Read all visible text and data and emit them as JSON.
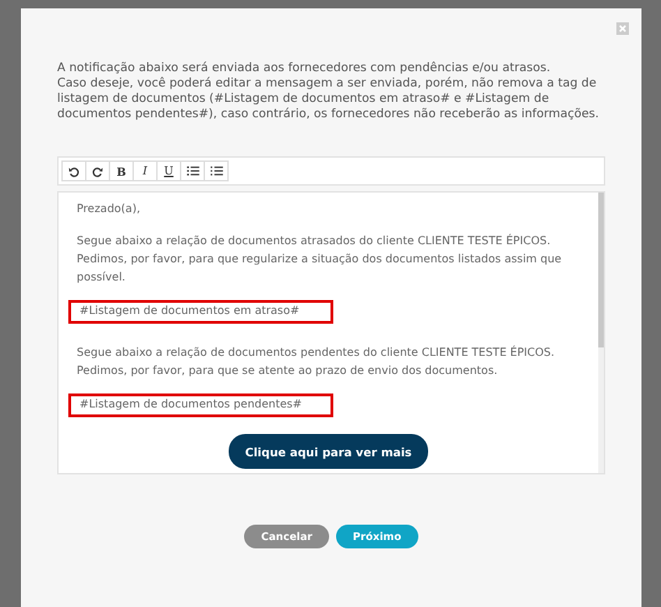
{
  "intro": [
    "A notificação abaixo será enviada aos fornecedores com pendências e/ou atrasos.",
    "Caso deseje, você poderá editar a mensagem a ser enviada, porém, não remova a tag de listagem de documentos (#Listagem de documentos em atraso# e #Listagem de documentos pendentes#), caso contrário, os fornecedores não receberão as informações."
  ],
  "toolbar": [
    {
      "kind": "undo"
    },
    {
      "kind": "redo"
    },
    {
      "kind": "bold",
      "label": "B"
    },
    {
      "kind": "italic",
      "label": "I"
    },
    {
      "kind": "underline",
      "label": "U"
    },
    {
      "kind": "bullets"
    },
    {
      "kind": "numbers"
    }
  ],
  "editor": [
    {
      "kind": "text",
      "text": "Prezado(a),"
    },
    {
      "kind": "text",
      "text": "Segue abaixo a relação de documentos atrasados do cliente CLIENTE TESTE ÉPICOS. Pedimos, por favor, para que regularize a situação dos documentos listados assim que possível."
    },
    {
      "kind": "tag",
      "text": "#Listagem de documentos em atraso#"
    },
    {
      "kind": "text",
      "text": "Segue abaixo a relação de documentos pendentes do cliente CLIENTE TESTE ÉPICOS. Pedimos, por favor, para que se atente ao prazo de envio dos documentos."
    },
    {
      "kind": "tag",
      "text": "#Listagem de documentos pendentes#"
    },
    {
      "kind": "button",
      "text": "Clique aqui para ver mais"
    }
  ],
  "buttons": [
    {
      "kind": "cancel",
      "label": "Cancelar"
    },
    {
      "kind": "next",
      "label": "Próximo"
    }
  ]
}
